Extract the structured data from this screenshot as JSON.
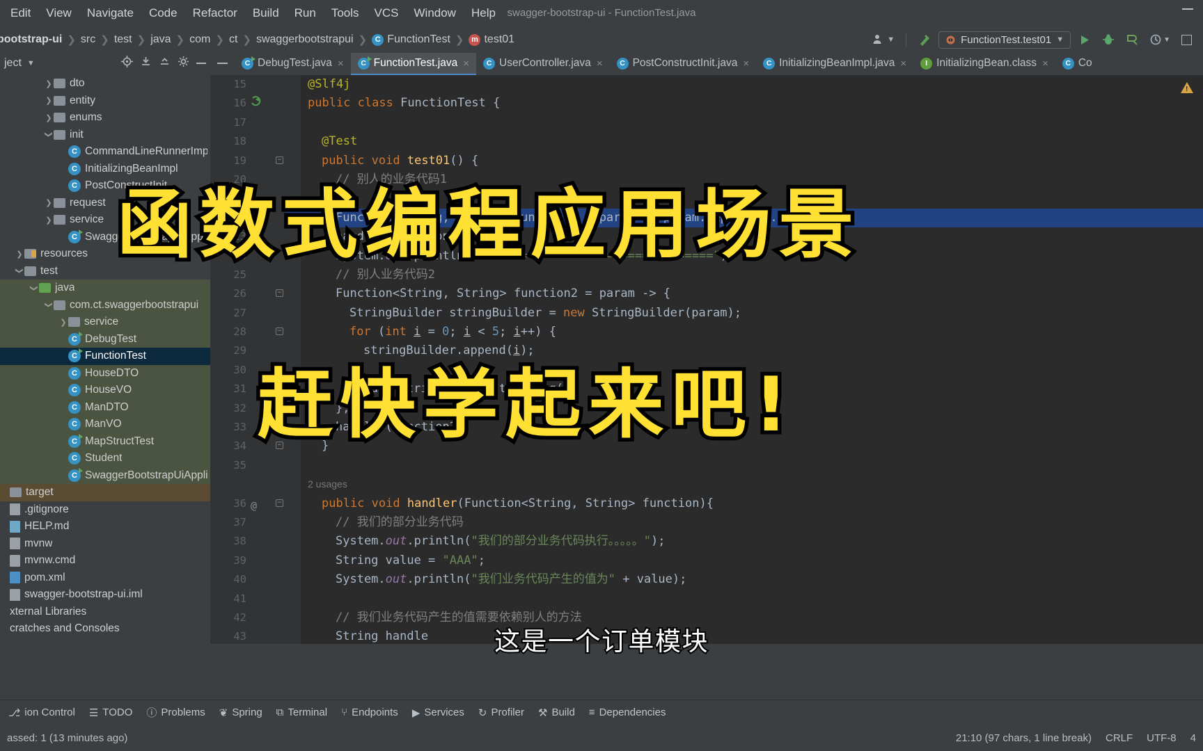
{
  "window": {
    "title": "swagger-bootstrap-ui - FunctionTest.java",
    "minimize_label": "—"
  },
  "menubar": {
    "items": [
      "Edit",
      "View",
      "Navigate",
      "Code",
      "Refactor",
      "Build",
      "Run",
      "Tools",
      "VCS",
      "Window",
      "Help"
    ]
  },
  "breadcrumb": {
    "items": [
      "bootstrap-ui",
      "src",
      "test",
      "java",
      "com",
      "ct",
      "swaggerbootstrapui",
      "FunctionTest",
      "test01"
    ],
    "class_icon": "class-icon",
    "method_icon": "method-icon"
  },
  "toolbar_right": {
    "profile_icon": "user-profile-icon",
    "chevron_icon": "chevron-down-icon",
    "hammer_icon": "build-hammer-icon",
    "run_config": "FunctionTest.test01",
    "run_config_icon": "run-config-icon",
    "run_icon": "run-button",
    "debug_icon": "debug-button",
    "coverage_icon": "coverage-button",
    "profile_run_icon": "profiler-button",
    "more_icon": "more-button",
    "search_icon": "search-icon"
  },
  "project_panel": {
    "title": "ject",
    "icons": [
      "locate-icon",
      "collapse-all-icon",
      "expand-all-icon",
      "settings-gear-icon",
      "hide-icon"
    ],
    "tree": [
      {
        "label": "dto",
        "type": "folder",
        "indent": 3,
        "arrow": "collapsed"
      },
      {
        "label": "entity",
        "type": "folder",
        "indent": 3,
        "arrow": "collapsed"
      },
      {
        "label": "enums",
        "type": "folder",
        "indent": 3,
        "arrow": "collapsed"
      },
      {
        "label": "init",
        "type": "folder",
        "indent": 3,
        "arrow": "expanded"
      },
      {
        "label": "CommandLineRunnerImpl",
        "type": "class",
        "indent": 4,
        "arrow": "none"
      },
      {
        "label": "InitializingBeanImpl",
        "type": "class",
        "indent": 4,
        "arrow": "none"
      },
      {
        "label": "PostConstructInit",
        "type": "class",
        "indent": 4,
        "arrow": "none"
      },
      {
        "label": "request",
        "type": "folder",
        "indent": 3,
        "arrow": "collapsed"
      },
      {
        "label": "service",
        "type": "folder",
        "indent": 3,
        "arrow": "collapsed"
      },
      {
        "label": "SwaggerBootstrapUiApplication",
        "type": "class-run",
        "indent": 4,
        "arrow": "none"
      },
      {
        "label": "resources",
        "type": "folder-res",
        "indent": 1,
        "arrow": "collapsed"
      },
      {
        "label": "test",
        "type": "folder",
        "indent": 1,
        "arrow": "expanded",
        "style": "plain"
      },
      {
        "label": "java",
        "type": "folder-green",
        "indent": 2,
        "arrow": "expanded",
        "style": "source"
      },
      {
        "label": "com.ct.swaggerbootstrapui",
        "type": "folder",
        "indent": 3,
        "arrow": "expanded",
        "style": "source"
      },
      {
        "label": "service",
        "type": "folder",
        "indent": 4,
        "arrow": "collapsed",
        "style": "source"
      },
      {
        "label": "DebugTest",
        "type": "class-run",
        "indent": 4,
        "arrow": "none",
        "style": "source"
      },
      {
        "label": "FunctionTest",
        "type": "class-run",
        "indent": 4,
        "arrow": "none",
        "style": "selected"
      },
      {
        "label": "HouseDTO",
        "type": "class",
        "indent": 4,
        "arrow": "none",
        "style": "source"
      },
      {
        "label": "HouseVO",
        "type": "class",
        "indent": 4,
        "arrow": "none",
        "style": "source"
      },
      {
        "label": "ManDTO",
        "type": "class",
        "indent": 4,
        "arrow": "none",
        "style": "source"
      },
      {
        "label": "ManVO",
        "type": "class",
        "indent": 4,
        "arrow": "none",
        "style": "source"
      },
      {
        "label": "MapStructTest",
        "type": "class-run",
        "indent": 4,
        "arrow": "none",
        "style": "source"
      },
      {
        "label": "Student",
        "type": "class",
        "indent": 4,
        "arrow": "none",
        "style": "source"
      },
      {
        "label": "SwaggerBootstrapUiApplicationTests",
        "type": "class-run",
        "indent": 4,
        "arrow": "none",
        "style": "source"
      },
      {
        "label": "target",
        "type": "folder",
        "indent": 0,
        "arrow": "none",
        "style": "target"
      },
      {
        "label": ".gitignore",
        "type": "file-gi",
        "indent": 0,
        "arrow": "none"
      },
      {
        "label": "HELP.md",
        "type": "file-md",
        "indent": 0,
        "arrow": "none"
      },
      {
        "label": "mvnw",
        "type": "file",
        "indent": 0,
        "arrow": "none"
      },
      {
        "label": "mvnw.cmd",
        "type": "file",
        "indent": 0,
        "arrow": "none"
      },
      {
        "label": "pom.xml",
        "type": "file-xml",
        "indent": 0,
        "arrow": "none"
      },
      {
        "label": "swagger-bootstrap-ui.iml",
        "type": "file",
        "indent": 0,
        "arrow": "none"
      },
      {
        "label": "xternal Libraries",
        "type": "none",
        "indent": 0,
        "arrow": "none"
      },
      {
        "label": "cratches and Consoles",
        "type": "none",
        "indent": 0,
        "arrow": "none"
      }
    ]
  },
  "editor_tabs": [
    {
      "label": "DebugTest.java",
      "icon": "class-run-icon",
      "active": false
    },
    {
      "label": "FunctionTest.java",
      "icon": "class-run-icon",
      "active": true
    },
    {
      "label": "UserController.java",
      "icon": "class-icon",
      "active": false
    },
    {
      "label": "PostConstructInit.java",
      "icon": "class-icon",
      "active": false
    },
    {
      "label": "InitializingBeanImpl.java",
      "icon": "class-icon",
      "active": false
    },
    {
      "label": "InitializingBean.class",
      "icon": "interface-icon",
      "active": false
    },
    {
      "label": "Co",
      "icon": "class-icon",
      "active": false
    }
  ],
  "code": {
    "usages_label": "2 usages",
    "lines": [
      {
        "num": "15",
        "indent": 0,
        "gutter": "",
        "tokens": [
          {
            "t": "@Slf4j",
            "c": "ann"
          }
        ]
      },
      {
        "num": "16",
        "indent": 0,
        "gutter": "override-icon",
        "tokens": [
          {
            "t": "public ",
            "c": "kw"
          },
          {
            "t": "class ",
            "c": "kw"
          },
          {
            "t": "FunctionTest {",
            "c": "pln"
          }
        ]
      },
      {
        "num": "17",
        "indent": 0,
        "tokens": []
      },
      {
        "num": "18",
        "indent": 1,
        "tokens": [
          {
            "t": "@Test",
            "c": "ann"
          }
        ]
      },
      {
        "num": "19",
        "indent": 1,
        "fold": true,
        "tokens": [
          {
            "t": "public ",
            "c": "kw"
          },
          {
            "t": "void ",
            "c": "kw"
          },
          {
            "t": "test01",
            "c": "mth"
          },
          {
            "t": "() {",
            "c": "pln"
          }
        ]
      },
      {
        "num": "20",
        "indent": 2,
        "tokens": [
          {
            "t": "// 别人的业务代码1",
            "c": "cmt"
          }
        ]
      },
      {
        "num": "21",
        "indent": 2,
        "tokens": []
      },
      {
        "num": "22",
        "indent": 2,
        "highlight": "sel",
        "tokens": [
          {
            "t": "Function<String, String> function1 = param -> param.replace(...);",
            "c": "pln"
          }
        ]
      },
      {
        "num": "23",
        "indent": 2,
        "tokens": [
          {
            "t": "handler(function1);",
            "c": "pln"
          }
        ]
      },
      {
        "num": "24",
        "indent": 2,
        "tokens": [
          {
            "t": "System.",
            "c": "pln"
          },
          {
            "t": "out",
            "c": "fld"
          },
          {
            "t": ".println(",
            "c": "pln"
          },
          {
            "t": "\"=================================\"",
            "c": "str"
          },
          {
            "t": ");",
            "c": "pln"
          }
        ]
      },
      {
        "num": "25",
        "indent": 2,
        "tokens": [
          {
            "t": "// 别人业务代码2",
            "c": "cmt"
          }
        ]
      },
      {
        "num": "26",
        "indent": 2,
        "fold": true,
        "tokens": [
          {
            "t": "Function<String, String> function2 = param -> {",
            "c": "pln"
          }
        ]
      },
      {
        "num": "27",
        "indent": 3,
        "tokens": [
          {
            "t": "StringBuilder stringBuilder = ",
            "c": "pln"
          },
          {
            "t": "new ",
            "c": "kw"
          },
          {
            "t": "StringBuilder(param);",
            "c": "pln"
          }
        ]
      },
      {
        "num": "28",
        "indent": 3,
        "fold": true,
        "tokens": [
          {
            "t": "for ",
            "c": "kw"
          },
          {
            "t": "(",
            "c": "pln"
          },
          {
            "t": "int ",
            "c": "kw"
          },
          {
            "t": "i",
            "c": "und"
          },
          {
            "t": " = ",
            "c": "pln"
          },
          {
            "t": "0",
            "c": "num"
          },
          {
            "t": "; ",
            "c": "pln"
          },
          {
            "t": "i",
            "c": "und"
          },
          {
            "t": " < ",
            "c": "pln"
          },
          {
            "t": "5",
            "c": "num"
          },
          {
            "t": "; ",
            "c": "pln"
          },
          {
            "t": "i",
            "c": "und"
          },
          {
            "t": "++) {",
            "c": "pln"
          }
        ]
      },
      {
        "num": "29",
        "indent": 4,
        "tokens": [
          {
            "t": "stringBuilder.append(",
            "c": "pln"
          },
          {
            "t": "i",
            "c": "und"
          },
          {
            "t": ");",
            "c": "pln"
          }
        ]
      },
      {
        "num": "30",
        "indent": 3,
        "tokens": [
          {
            "t": "}",
            "c": "pln"
          }
        ]
      },
      {
        "num": "31",
        "indent": 3,
        "tokens": [
          {
            "t": "return stringBuilder.toString();",
            "c": "pln"
          }
        ]
      },
      {
        "num": "32",
        "indent": 2,
        "tokens": [
          {
            "t": "};",
            "c": "pln"
          }
        ]
      },
      {
        "num": "33",
        "indent": 2,
        "tokens": [
          {
            "t": "handler(function2);",
            "c": "pln"
          }
        ]
      },
      {
        "num": "34",
        "indent": 1,
        "fold": true,
        "tokens": [
          {
            "t": "}",
            "c": "pln"
          }
        ]
      },
      {
        "num": "35",
        "indent": 0,
        "tokens": []
      },
      {
        "num": "36",
        "indent": 1,
        "gutter": "@",
        "fold": true,
        "usages": true,
        "tokens": [
          {
            "t": "public ",
            "c": "kw"
          },
          {
            "t": "void ",
            "c": "kw"
          },
          {
            "t": "handler",
            "c": "mth"
          },
          {
            "t": "(Function<String, String> function){",
            "c": "pln"
          }
        ]
      },
      {
        "num": "37",
        "indent": 2,
        "tokens": [
          {
            "t": "// 我们的部分业务代码",
            "c": "cmt"
          }
        ]
      },
      {
        "num": "38",
        "indent": 2,
        "tokens": [
          {
            "t": "System.",
            "c": "pln"
          },
          {
            "t": "out",
            "c": "fld"
          },
          {
            "t": ".println(",
            "c": "pln"
          },
          {
            "t": "\"我们的部分业务代码执行。。。。。\"",
            "c": "str"
          },
          {
            "t": ");",
            "c": "pln"
          }
        ]
      },
      {
        "num": "39",
        "indent": 2,
        "tokens": [
          {
            "t": "String value = ",
            "c": "pln"
          },
          {
            "t": "\"AAA\"",
            "c": "str"
          },
          {
            "t": ";",
            "c": "pln"
          }
        ]
      },
      {
        "num": "40",
        "indent": 2,
        "tokens": [
          {
            "t": "System.",
            "c": "pln"
          },
          {
            "t": "out",
            "c": "fld"
          },
          {
            "t": ".println(",
            "c": "pln"
          },
          {
            "t": "\"我们业务代码产生的值为\"",
            "c": "str"
          },
          {
            "t": " + value);",
            "c": "pln"
          }
        ]
      },
      {
        "num": "41",
        "indent": 0,
        "tokens": []
      },
      {
        "num": "42",
        "indent": 2,
        "tokens": [
          {
            "t": "// 我们业务代码产生的值需要依赖别人的方法",
            "c": "cmt"
          }
        ]
      },
      {
        "num": "43",
        "indent": 2,
        "tokens": [
          {
            "t": "String handle",
            "c": "pln"
          }
        ]
      }
    ]
  },
  "tool_windows": [
    {
      "label": "ion Control",
      "icon": "version-control-icon"
    },
    {
      "label": "TODO",
      "icon": "todo-icon"
    },
    {
      "label": "Problems",
      "icon": "problems-icon"
    },
    {
      "label": "Spring",
      "icon": "spring-icon"
    },
    {
      "label": "Terminal",
      "icon": "terminal-icon"
    },
    {
      "label": "Endpoints",
      "icon": "endpoints-icon"
    },
    {
      "label": "Services",
      "icon": "services-icon"
    },
    {
      "label": "Profiler",
      "icon": "profiler-icon"
    },
    {
      "label": "Build",
      "icon": "build-icon"
    },
    {
      "label": "Dependencies",
      "icon": "dependencies-icon"
    }
  ],
  "status_bar": {
    "left": "assed: 1 (13 minutes ago)",
    "caret": "21:10 (97 chars, 1 line break)",
    "line_sep": "CRLF",
    "encoding": "UTF-8",
    "indent": "4"
  },
  "overlay": {
    "line1": "函数式编程应用场景",
    "line2": "赶快学起来吧!",
    "subtitle": "这是一个订单模块"
  },
  "colors": {
    "accent": "#4a88c7",
    "selection": "#214283",
    "overlay_yellow": "#ffe033",
    "editor_bg": "#2b2b2b",
    "chrome_bg": "#3c3f41"
  }
}
